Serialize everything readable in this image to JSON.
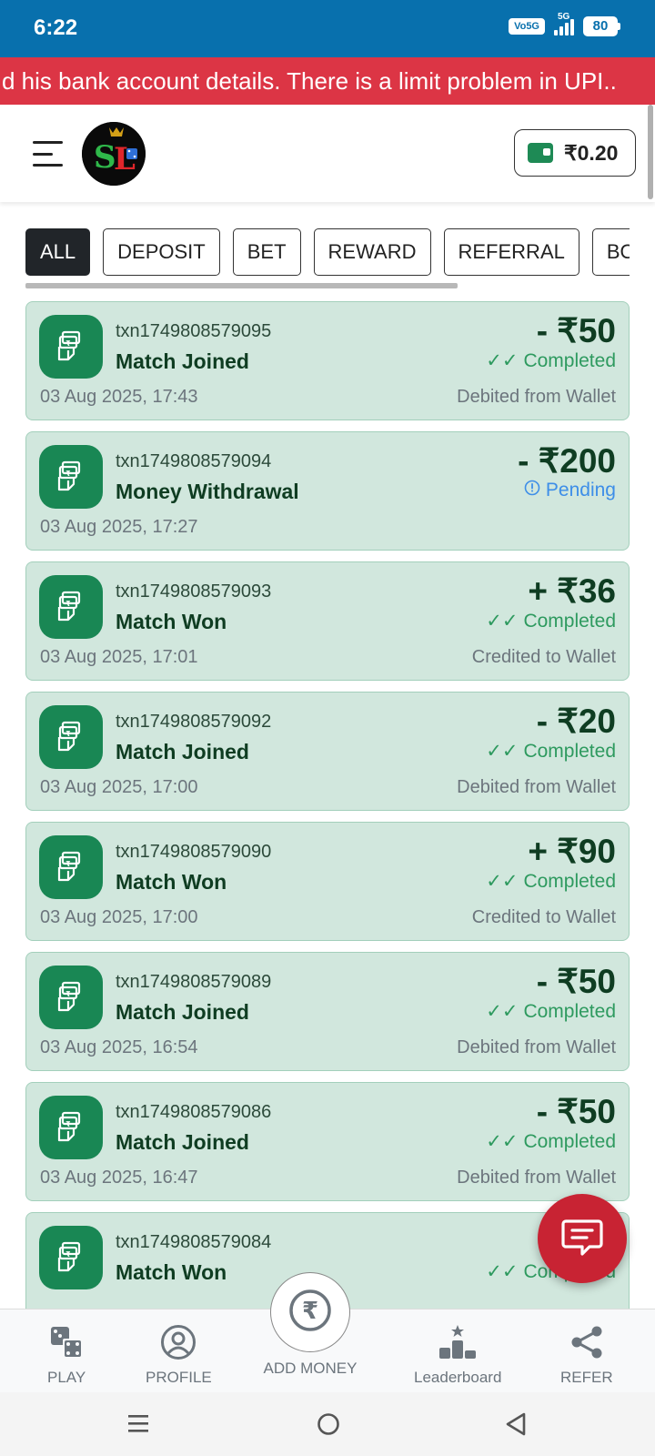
{
  "status_bar": {
    "time": "6:22",
    "network": "Vo5G",
    "signal_label": "5G",
    "battery": "80"
  },
  "ticker": {
    "text": "d his bank account details. There is a limit problem in UPI.."
  },
  "header": {
    "logo_text": "SL",
    "wallet_balance": "₹0.20"
  },
  "filters": [
    "ALL",
    "DEPOSIT",
    "BET",
    "REWARD",
    "REFERRAL",
    "BO"
  ],
  "active_filter": "ALL",
  "transactions": [
    {
      "id": "txn1749808579095",
      "title": "Match Joined",
      "amount": "- ₹50",
      "status": "Completed",
      "date": "03 Aug 2025, 17:43",
      "note": "Debited from Wallet"
    },
    {
      "id": "txn1749808579094",
      "title": "Money Withdrawal",
      "amount": "- ₹200",
      "status": "Pending",
      "date": "03 Aug 2025, 17:27",
      "note": ""
    },
    {
      "id": "txn1749808579093",
      "title": "Match Won",
      "amount": "+ ₹36",
      "status": "Completed",
      "date": "03 Aug 2025, 17:01",
      "note": "Credited to Wallet"
    },
    {
      "id": "txn1749808579092",
      "title": "Match Joined",
      "amount": "- ₹20",
      "status": "Completed",
      "date": "03 Aug 2025, 17:00",
      "note": "Debited from Wallet"
    },
    {
      "id": "txn1749808579090",
      "title": "Match Won",
      "amount": "+ ₹90",
      "status": "Completed",
      "date": "03 Aug 2025, 17:00",
      "note": "Credited to Wallet"
    },
    {
      "id": "txn1749808579089",
      "title": "Match Joined",
      "amount": "- ₹50",
      "status": "Completed",
      "date": "03 Aug 2025, 16:54",
      "note": "Debited from Wallet"
    },
    {
      "id": "txn1749808579086",
      "title": "Match Joined",
      "amount": "- ₹50",
      "status": "Completed",
      "date": "03 Aug 2025, 16:47",
      "note": "Debited from Wallet"
    },
    {
      "id": "txn1749808579084",
      "title": "Match Won",
      "amount": "+",
      "status": "Completed",
      "date": "",
      "note": ""
    }
  ],
  "bottom_nav": {
    "play": "PLAY",
    "profile": "PROFILE",
    "add_money": "ADD MONEY",
    "leaderboard": "Leaderboard",
    "refer": "REFER"
  },
  "colors": {
    "status_bar": "#0870ad",
    "ticker": "#dc3545",
    "card_bg": "#d1e7dd",
    "icon_bg": "#198754",
    "completed": "#2e9a5f",
    "pending": "#3d8ee8",
    "fab": "#c82333"
  }
}
